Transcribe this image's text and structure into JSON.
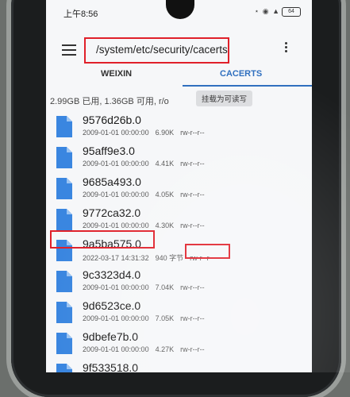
{
  "status_bar": {
    "time": "上午8:56",
    "right_icons": "⋆ ◉ ▲",
    "battery": "64"
  },
  "app_bar": {
    "path": "/system/etc/security/cacerts"
  },
  "tabs": [
    {
      "label": "WEIXIN",
      "active": false
    },
    {
      "label": "CACERTS",
      "active": true
    }
  ],
  "storage": {
    "info": "2.99GB 已用, 1.36GB 可用, r/o",
    "remount_label": "挂载为可读写"
  },
  "files": [
    {
      "name": "9576d26b.0",
      "date": "2009-01-01 00:00:00",
      "size": "6.90K",
      "perms": "rw-r--r--"
    },
    {
      "name": "95aff9e3.0",
      "date": "2009-01-01 00:00:00",
      "size": "4.41K",
      "perms": "rw-r--r--"
    },
    {
      "name": "9685a493.0",
      "date": "2009-01-01 00:00:00",
      "size": "4.05K",
      "perms": "rw-r--r--"
    },
    {
      "name": "9772ca32.0",
      "date": "2009-01-01 00:00:00",
      "size": "4.30K",
      "perms": "rw-r--r--"
    },
    {
      "name": "9a5ba575.0",
      "date": "2022-03-17 14:31:32",
      "size": "940 字节",
      "perms": "rw-r--r--"
    },
    {
      "name": "9c3323d4.0",
      "date": "2009-01-01 00:00:00",
      "size": "7.04K",
      "perms": "rw-r--r--"
    },
    {
      "name": "9d6523ce.0",
      "date": "2009-01-01 00:00:00",
      "size": "7.05K",
      "perms": "rw-r--r--"
    },
    {
      "name": "9dbefe7b.0",
      "date": "2009-01-01 00:00:00",
      "size": "4.27K",
      "perms": "rw-r--r--"
    },
    {
      "name": "9f533518.0",
      "date": "",
      "size": "",
      "perms": ""
    }
  ],
  "colors": {
    "accent": "#2f6fbf",
    "file_icon": "#3a86e0",
    "annotation": "#e0202a"
  }
}
